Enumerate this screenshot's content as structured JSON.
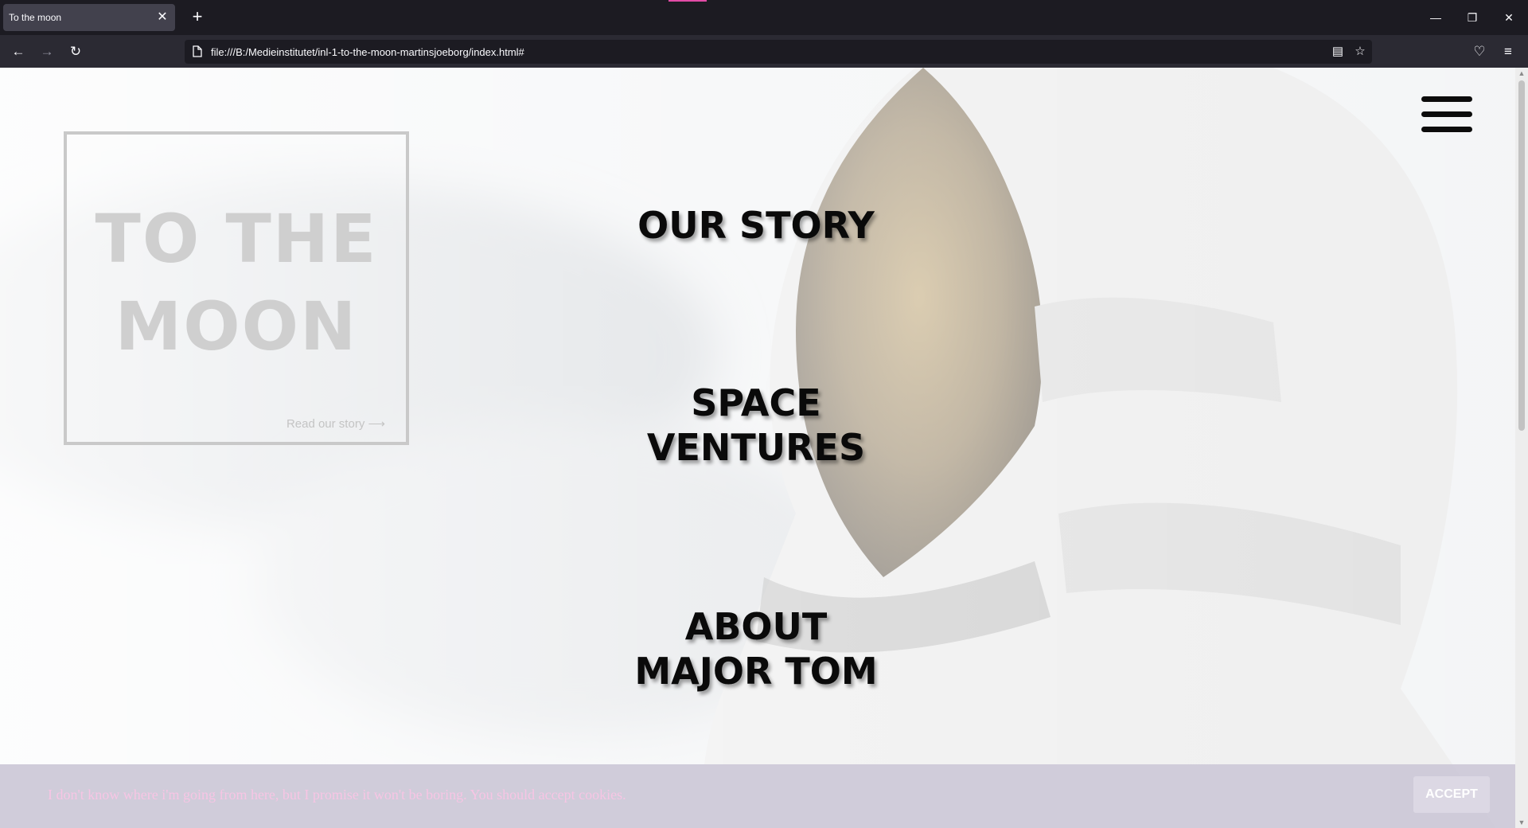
{
  "browser": {
    "tab_title": "To the moon",
    "url": "file:///B:/Medieinstitutet/inl-1-to-the-moon-martinsjoeborg/index.html#"
  },
  "icons": {
    "tab_close": "close-icon",
    "new_tab": "plus-icon",
    "back": "arrow-left-icon",
    "forward": "arrow-right-icon",
    "reload": "reload-icon",
    "reader": "reader-view-icon",
    "bookmark": "star-icon",
    "pocket": "pocket-icon",
    "menu": "hamburger-icon"
  },
  "hero": {
    "title_line1": "TO THE",
    "title_line2": "MOON",
    "link": "Read our story ⟶"
  },
  "menu": {
    "item1": "OUR STORY",
    "item2_line1": "SPACE",
    "item2_line2": "VENTURES",
    "item3_line1": "ABOUT",
    "item3_line2": "MAJOR TOM"
  },
  "cookie": {
    "text": "I don't know where i'm going from here, but I promise it won't be boring. You should accept cookies.",
    "button": "ACCEPT"
  },
  "colors": {
    "menu_text": "#0a0a0a",
    "hero_text": "#cfcfcf",
    "cookie_bg": "#cdc9d8",
    "cookie_text": "#f7c5e4"
  }
}
